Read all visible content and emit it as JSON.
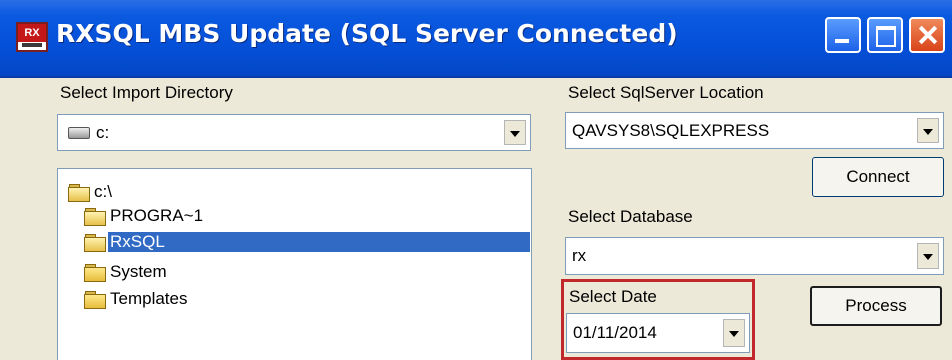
{
  "window": {
    "title": "RXSQL MBS Update (SQL Server Connected)",
    "icon_name": "rxsql-app-icon",
    "controls": [
      "minimize",
      "maximize",
      "close"
    ]
  },
  "import_directory": {
    "label": "Select Import Directory",
    "drive_value": "c:",
    "tree": [
      {
        "label": "c:\\",
        "state": "open"
      },
      {
        "label": "PROGRA~1",
        "state": "open"
      },
      {
        "label": "RxSQL",
        "state": "open-selected"
      },
      {
        "label": "System",
        "state": "closed"
      },
      {
        "label": "Templates",
        "state": "closed"
      }
    ]
  },
  "sql_server": {
    "label": "Select SqlServer Location",
    "value": "QAVSYS8\\SQLEXPRESS",
    "connect_label": "Connect"
  },
  "database": {
    "label": "Select Database",
    "value": "rx"
  },
  "date": {
    "label": "Select Date",
    "value": "01/11/2014"
  },
  "process_label": "Process",
  "colors": {
    "titlebar": "#0550d8",
    "selection": "#316ac5",
    "highlight_border": "#c0282c",
    "window_bg": "#ece9d8"
  }
}
